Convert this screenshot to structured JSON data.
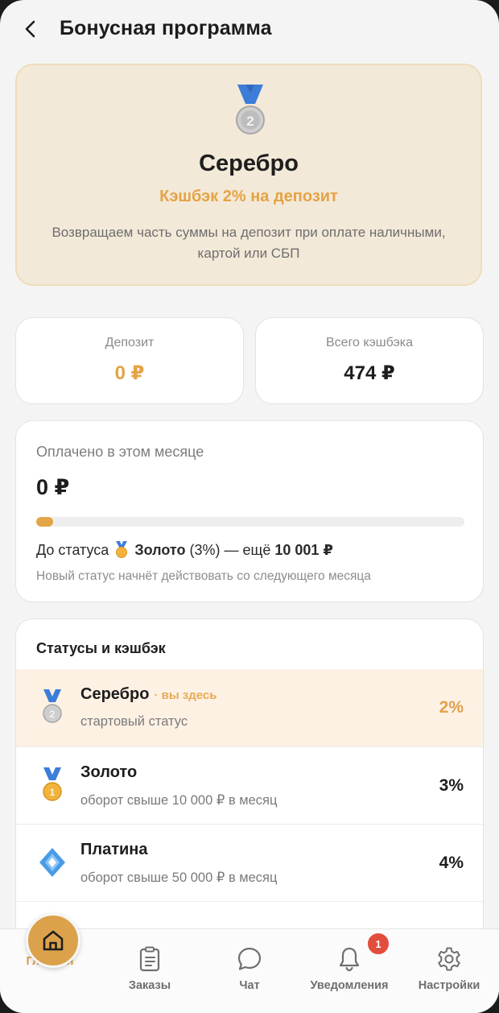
{
  "header": {
    "title": "Бонусная программа",
    "back_icon": "chevron-left-icon"
  },
  "hero": {
    "medal_icon": "silver-medal-icon",
    "status": "Серебро",
    "cashback": "Кэшбэк 2% на депозит",
    "description": "Возвращаем часть суммы на депозит при оплате наличными, картой или СБП"
  },
  "stats": {
    "deposit": {
      "label": "Депозит",
      "value": "0 ₽"
    },
    "total_cashback": {
      "label": "Всего кэшбэка",
      "value": "474 ₽"
    }
  },
  "month": {
    "label": "Оплачено в этом месяце",
    "value": "0 ₽",
    "progress_percent": 4,
    "next_prefix": "До статуса",
    "next_status": "Золото",
    "next_pct": "(3%) — ещё",
    "next_amount": "10 001 ₽",
    "note": "Новый статус начнёт действовать со следующего месяца"
  },
  "levels": {
    "title": "Статусы и кэшбэк",
    "current_tag": "· вы здесь",
    "items": [
      {
        "name": "Серебро",
        "desc": "стартовый статус",
        "pct": "2%",
        "icon": "silver-medal-icon"
      },
      {
        "name": "Золото",
        "desc": "оборот свыше 10 000 ₽ в месяц",
        "pct": "3%",
        "icon": "gold-medal-icon"
      },
      {
        "name": "Платина",
        "desc": "оборот свыше 50 000 ₽ в месяц",
        "pct": "4%",
        "icon": "platinum-diamond-icon"
      }
    ]
  },
  "tabbar": {
    "home": "Главная",
    "orders": "Заказы",
    "chat": "Чат",
    "notifications": "Уведомления",
    "notifications_badge": "1",
    "settings": "Настройки"
  },
  "colors": {
    "accent": "#e4a346",
    "hero_bg": "#f3e9d8",
    "current_row_bg": "#fdf1e4",
    "badge": "#e24d3e"
  }
}
